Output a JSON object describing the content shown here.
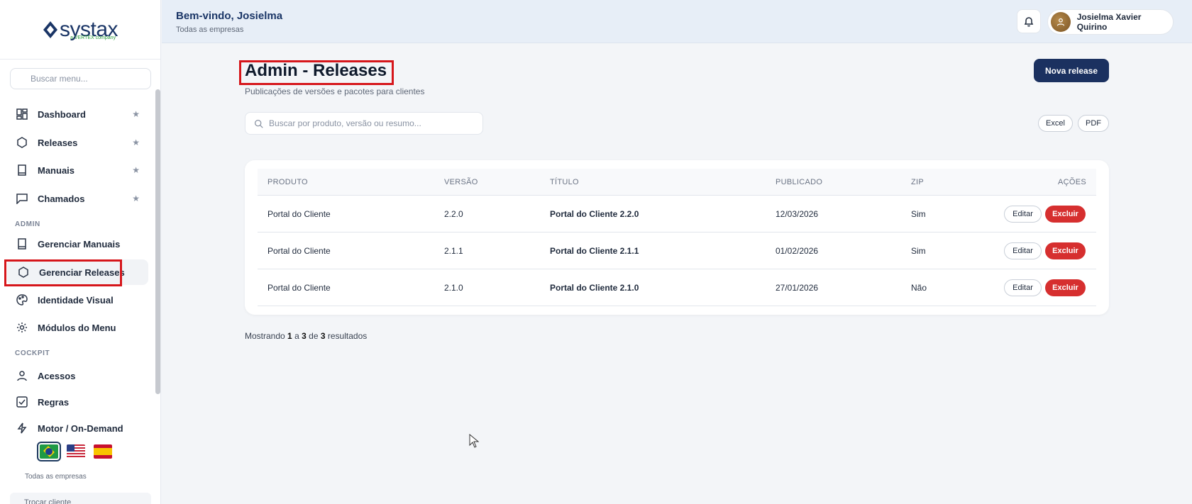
{
  "brand": {
    "name": "systax",
    "tagline": "a VERTEX company"
  },
  "sidebar": {
    "search_placeholder": "Buscar menu...",
    "items": [
      {
        "label": "Dashboard",
        "icon": "dashboard-icon",
        "starred": true
      },
      {
        "label": "Releases",
        "icon": "hexagon-icon",
        "starred": true
      },
      {
        "label": "Manuais",
        "icon": "book-icon",
        "starred": true
      },
      {
        "label": "Chamados",
        "icon": "chat-icon",
        "starred": true
      }
    ],
    "admin_section": "ADMIN",
    "admin_items": [
      {
        "label": "Gerenciar Manuais",
        "icon": "book-icon"
      },
      {
        "label": "Gerenciar Releases",
        "icon": "hexagon-icon"
      },
      {
        "label": "Identidade Visual",
        "icon": "palette-icon"
      },
      {
        "label": "Módulos do Menu",
        "icon": "gear-icon"
      }
    ],
    "cockpit_section": "COCKPIT",
    "cockpit_items": [
      {
        "label": "Acessos",
        "icon": "user-icon"
      },
      {
        "label": "Regras",
        "icon": "checkbox-icon"
      },
      {
        "label": "Motor / On-Demand",
        "icon": "lightning-icon"
      }
    ],
    "languages": [
      "pt-BR",
      "en-US",
      "es-ES"
    ],
    "footer_company": "Todas as empresas",
    "switch_client": "Trocar cliente",
    "star": "★"
  },
  "header": {
    "welcome": "Bem-vindo, Josielma",
    "subtitle": "Todas as empresas",
    "user_name": "Josielma Xavier Quirino"
  },
  "main": {
    "title": "Admin - Releases",
    "subtitle": "Publicações de versões e pacotes para clientes",
    "new_button": "Nova release",
    "search_placeholder": "Buscar por produto, versão ou resumo...",
    "export_excel": "Excel",
    "export_pdf": "PDF",
    "table": {
      "headers": [
        "PRODUTO",
        "VERSÃO",
        "TÍTULO",
        "PUBLICADO",
        "ZIP",
        "AÇÕES"
      ],
      "rows": [
        {
          "produto": "Portal do Cliente",
          "versao": "2.2.0",
          "titulo": "Portal do Cliente 2.2.0",
          "publicado": "12/03/2026",
          "zip": "Sim"
        },
        {
          "produto": "Portal do Cliente",
          "versao": "2.1.1",
          "titulo": "Portal do Cliente 2.1.1",
          "publicado": "01/02/2026",
          "zip": "Sim"
        },
        {
          "produto": "Portal do Cliente",
          "versao": "2.1.0",
          "titulo": "Portal do Cliente 2.1.0",
          "publicado": "27/01/2026",
          "zip": "Não"
        }
      ],
      "edit_label": "Editar",
      "delete_label": "Excluir"
    },
    "results": {
      "prefix": "Mostrando",
      "from": "1",
      "a": "a",
      "to": "3",
      "de": "de",
      "total": "3",
      "suffix": "resultados"
    }
  },
  "colors": {
    "primary": "#1b3160",
    "danger": "#d62f2f",
    "highlight": "#d6161b"
  }
}
